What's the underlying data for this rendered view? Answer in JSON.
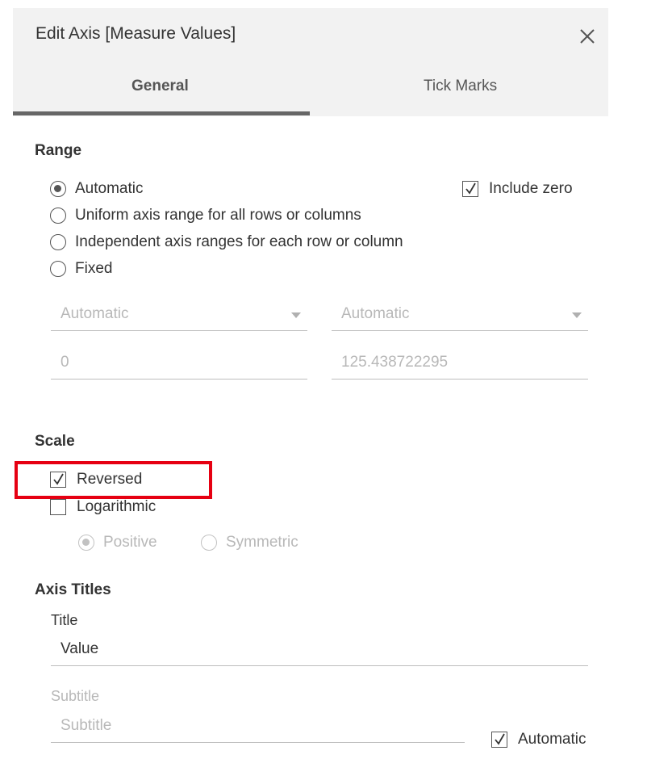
{
  "dialog": {
    "title": "Edit Axis [Measure Values]",
    "tabs": [
      {
        "label": "General",
        "active": true
      },
      {
        "label": "Tick Marks",
        "active": false
      }
    ]
  },
  "range": {
    "heading": "Range",
    "options": [
      {
        "label": "Automatic",
        "selected": true
      },
      {
        "label": "Uniform axis range for all rows or columns",
        "selected": false
      },
      {
        "label": "Independent axis ranges for each row or column",
        "selected": false
      },
      {
        "label": "Fixed",
        "selected": false
      }
    ],
    "include_zero": {
      "label": "Include zero",
      "checked": true
    },
    "start_select": "Automatic",
    "end_select": "Automatic",
    "start_value": "0",
    "end_value": "125.438722295"
  },
  "scale": {
    "heading": "Scale",
    "reversed": {
      "label": "Reversed",
      "checked": true
    },
    "logarithmic": {
      "label": "Logarithmic",
      "checked": false
    },
    "log_options": [
      {
        "label": "Positive",
        "selected": true
      },
      {
        "label": "Symmetric",
        "selected": false
      }
    ]
  },
  "axis_titles": {
    "heading": "Axis Titles",
    "title_label": "Title",
    "title_value": "Value",
    "subtitle_label": "Subtitle",
    "subtitle_placeholder": "Subtitle",
    "subtitle_automatic": {
      "label": "Automatic",
      "checked": true
    }
  },
  "colors": {
    "highlight": "#e60012",
    "header_bg": "#f2f2f2",
    "tab_underline": "#666666"
  }
}
